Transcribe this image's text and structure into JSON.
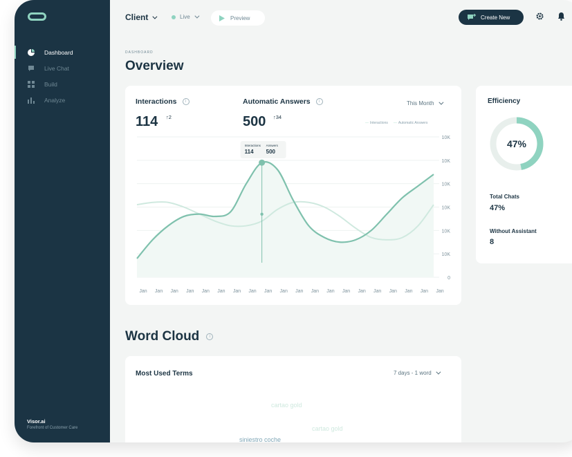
{
  "sidebar": {
    "items": [
      {
        "label": "Dashboard",
        "icon": "pie-chart-icon"
      },
      {
        "label": "Live Chat",
        "icon": "chat-icon"
      },
      {
        "label": "Build",
        "icon": "grid-icon"
      },
      {
        "label": "Analyze",
        "icon": "bar-chart-icon"
      }
    ],
    "brand_name": "Visor.ai",
    "brand_tagline": "Forefront of Customer Care"
  },
  "topbar": {
    "client_label": "Client",
    "status_label": "Live",
    "preview_label": "Preview",
    "create_label": "Create New"
  },
  "page": {
    "breadcrumb": "DASHBOARD",
    "title": "Overview"
  },
  "overview": {
    "interactions_label": "Interactions",
    "interactions_value": "114",
    "interactions_delta": "↑2",
    "answers_label": "Automatic Answers",
    "answers_value": "500",
    "answers_delta": "↑34",
    "period_label": "This Month",
    "tooltip": {
      "label1": "Interactions",
      "value1": "114",
      "label2": "Answers",
      "value2": "500"
    }
  },
  "chart_data": {
    "type": "line",
    "categories": [
      "Jan",
      "Jan",
      "Jan",
      "Jan",
      "Jan",
      "Jan",
      "Jan",
      "Jan",
      "Jan",
      "Jan",
      "Jan",
      "Jan",
      "Jan",
      "Jan",
      "Jan",
      "Jan",
      "Jan",
      "Jan",
      "Jan",
      "Jan"
    ],
    "y_tick_labels": [
      "10K",
      "10K",
      "10K",
      "10K",
      "10K",
      "10K",
      "0"
    ],
    "series": [
      {
        "name": "Interactions",
        "values": [
          3.1,
          3.2,
          3.2,
          3.0,
          2.7,
          2.4,
          2.2,
          2.2,
          2.4,
          2.9,
          3.2,
          3.2,
          3.0,
          2.6,
          2.1,
          1.7,
          1.6,
          1.7,
          2.2,
          3.1
        ]
      },
      {
        "name": "Automatic Answers",
        "values": [
          0.8,
          1.6,
          2.2,
          2.6,
          2.7,
          2.6,
          2.8,
          4.0,
          4.9,
          4.6,
          3.3,
          2.2,
          1.7,
          1.5,
          1.6,
          2.0,
          2.7,
          3.4,
          3.9,
          4.4
        ]
      }
    ],
    "colors": {
      "interactions": "#cfe9df",
      "answers": "#7fc1ad"
    },
    "ylim": [
      0,
      6
    ],
    "grid": true,
    "legend": "top-right"
  },
  "efficiency": {
    "title": "Efficiency",
    "percent_label": "47%",
    "percent": 47,
    "stats": [
      {
        "label": "Total Chats",
        "value": "47%"
      },
      {
        "label": "Without Assistant",
        "value": "8"
      }
    ]
  },
  "wordcloud": {
    "title": "Word Cloud",
    "card_title": "Most Used Terms",
    "range_label": "7 days - 1 word",
    "terms": [
      {
        "text": "cartao gold",
        "color": "#cfe9df"
      },
      {
        "text": "cartao gold",
        "color": "#cfe9df"
      },
      {
        "text": "siniestro coche",
        "color": "#7fa6b6"
      }
    ]
  },
  "colors": {
    "accent": "#8fd3c0",
    "navy": "#1b3444"
  }
}
